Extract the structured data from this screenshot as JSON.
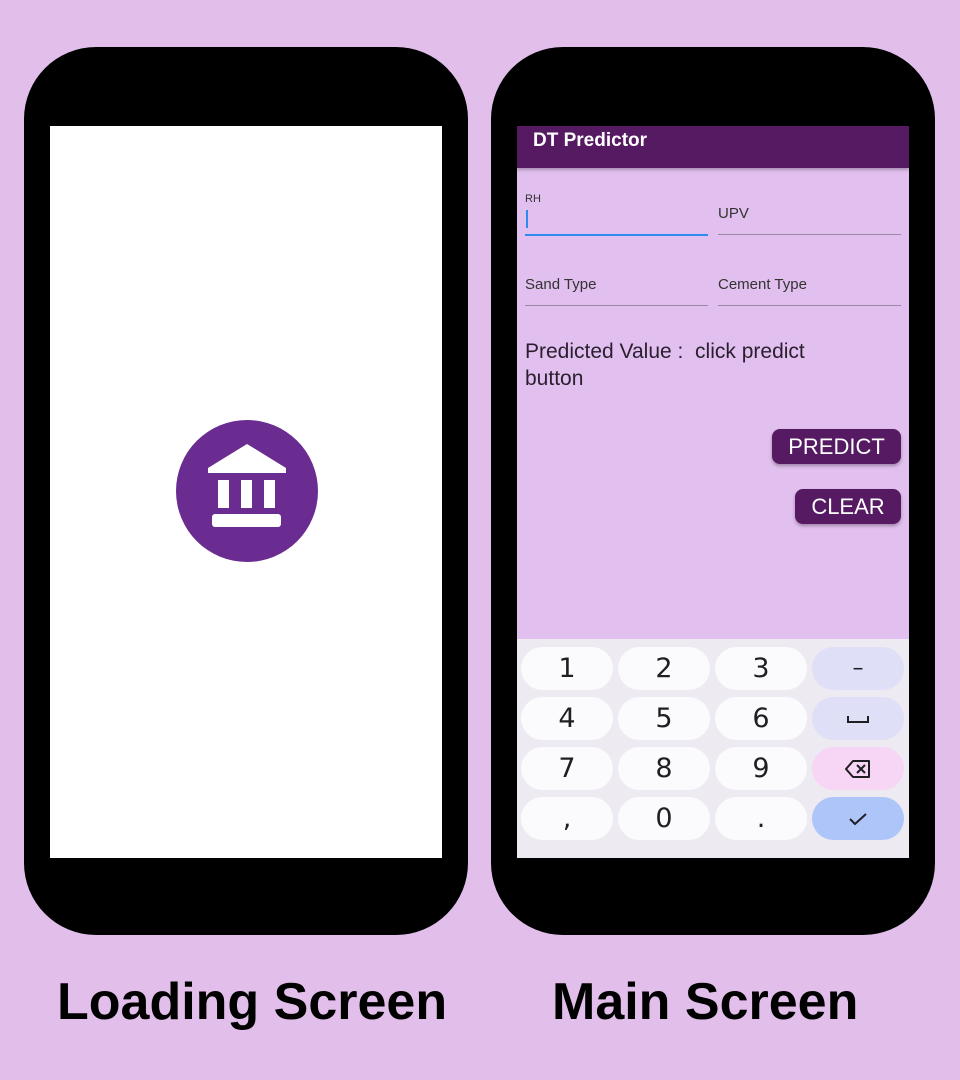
{
  "captions": {
    "left": "Loading Screen",
    "right": "Main Screen"
  },
  "loading": {
    "logo_icon": "bank-icon",
    "brand_color": "#6b2c91"
  },
  "app": {
    "title": "DT Predictor",
    "fields": {
      "rh_label": "RH",
      "upv_label": "UPV",
      "sand_label": "Sand Type",
      "cement_label": "Cement Type"
    },
    "predicted_label": "Predicted Value :",
    "predicted_value": "click predict button",
    "predict_button": "PREDICT",
    "clear_button": "CLEAR",
    "accent_color": "#561a62"
  },
  "keyboard": {
    "keys": [
      "1",
      "2",
      "3",
      "–",
      "4",
      "5",
      "6",
      "space",
      "7",
      "8",
      "9",
      "backspace",
      ",",
      "0",
      ".",
      "done"
    ]
  }
}
